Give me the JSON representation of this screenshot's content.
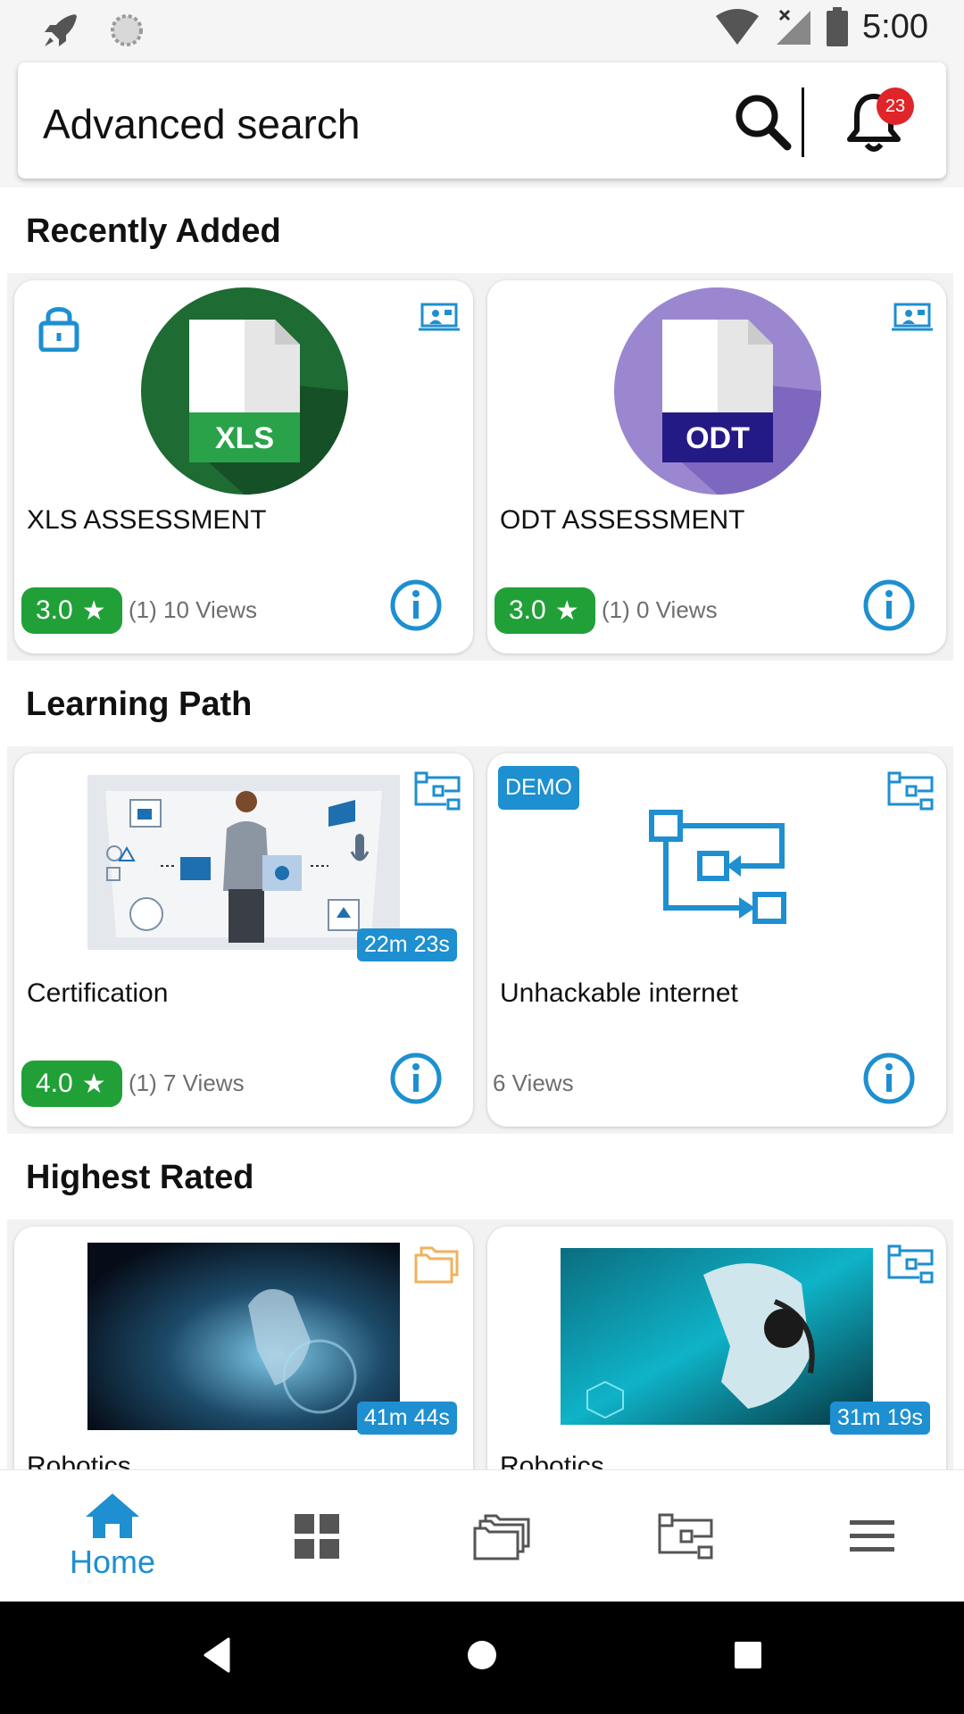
{
  "status_bar": {
    "time": "5:00"
  },
  "search": {
    "label": "Advanced search",
    "notification_count": "23"
  },
  "sections": {
    "recently_added": {
      "title": "Recently Added",
      "cards": [
        {
          "title": "XLS ASSESSMENT",
          "badge_text": "XLS",
          "rating": "3.0",
          "views": "(1) 10 Views",
          "locked": true,
          "type_icon": "virtual-classroom-icon"
        },
        {
          "title": "ODT ASSESSMENT",
          "badge_text": "ODT",
          "rating": "3.0",
          "views": "(1) 0 Views",
          "locked": false,
          "type_icon": "virtual-classroom-icon"
        }
      ]
    },
    "learning_path": {
      "title": "Learning Path",
      "cards": [
        {
          "title": "Certification",
          "duration": "22m 23s",
          "rating": "4.0",
          "views": "(1) 7 Views",
          "type_icon": "learning-path-icon"
        },
        {
          "title": "Unhackable internet",
          "demo_label": "DEMO",
          "views": "6 Views",
          "type_icon": "learning-path-icon"
        }
      ]
    },
    "highest_rated": {
      "title": "Highest Rated",
      "cards": [
        {
          "title": "Robotics",
          "duration": "41m 44s",
          "type_icon": "folder-icon"
        },
        {
          "title": "Robotics",
          "duration": "31m 19s",
          "type_icon": "learning-path-icon"
        }
      ]
    }
  },
  "nav": {
    "home_label": "Home"
  },
  "colors": {
    "accent": "#1e8fd0",
    "rating_green": "#21a038",
    "xls_green": "#1e6b34",
    "odt_purple": "#9b87cf",
    "badge_red": "#e0252a"
  }
}
